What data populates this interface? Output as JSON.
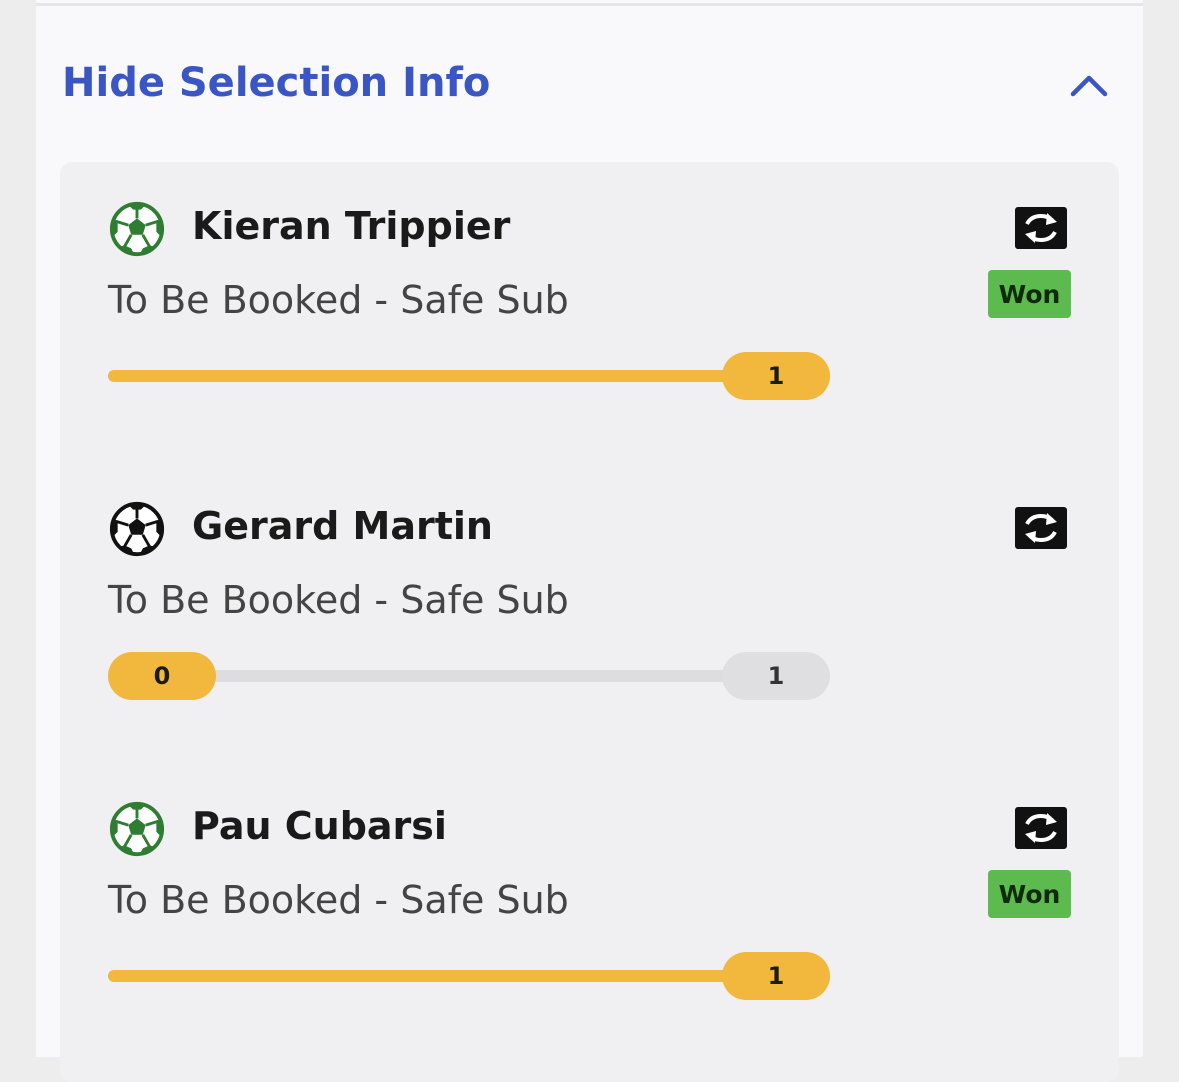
{
  "header": {
    "toggle_label": "Hide Selection Info",
    "toggle_icon": "chevron-up-icon"
  },
  "colors": {
    "link_blue": "#3a56c4",
    "progress_yellow": "#f2b83d",
    "won_green": "#5cba4f",
    "ball_green": "#2e7d32",
    "ball_black": "#111111"
  },
  "selections": [
    {
      "player": "Kieran Trippier",
      "market": "To Be Booked - Safe Sub",
      "icon": "soccer-ball-icon",
      "icon_color": "#2e7d32",
      "swap_icon": "swap-icon",
      "status": "Won",
      "progress": {
        "current": "",
        "target": "1",
        "fraction": 1.0
      }
    },
    {
      "player": "Gerard Martin",
      "market": "To Be Booked - Safe Sub",
      "icon": "soccer-ball-icon",
      "icon_color": "#111111",
      "swap_icon": "swap-icon",
      "status": "",
      "progress": {
        "current": "0",
        "target": "1",
        "fraction": 0.0
      }
    },
    {
      "player": "Pau Cubarsi",
      "market": "To Be Booked - Safe Sub",
      "icon": "soccer-ball-icon",
      "icon_color": "#2e7d32",
      "swap_icon": "swap-icon",
      "status": "Won",
      "progress": {
        "current": "",
        "target": "1",
        "fraction": 1.0
      }
    }
  ]
}
